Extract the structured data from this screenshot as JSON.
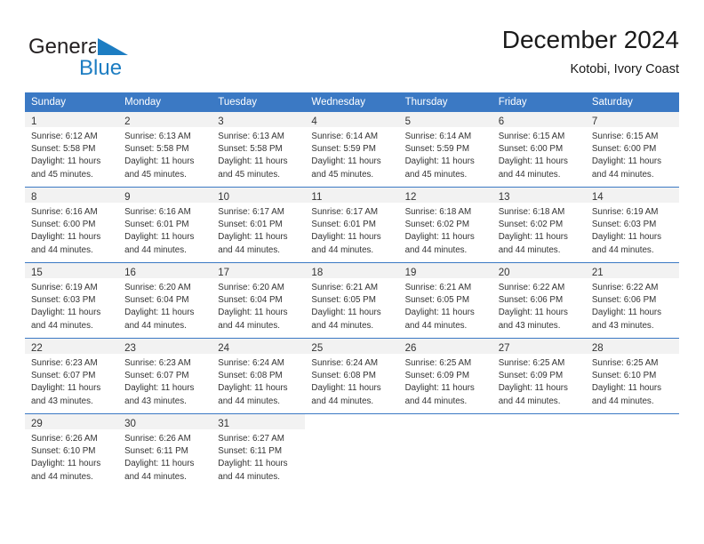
{
  "brand": {
    "name_top": "General",
    "name_bottom": "Blue",
    "triangle_icon": "blue-triangle-icon",
    "color_dark": "#231f20",
    "color_blue": "#1d7dc2"
  },
  "header": {
    "title": "December 2024",
    "subtitle": "Kotobi, Ivory Coast"
  },
  "theme": {
    "header_bg": "#3b79c4",
    "daynum_bg": "#f2f2f2",
    "text": "#333333",
    "page_bg": "#ffffff"
  },
  "calendar": {
    "weekday_headers": [
      "Sunday",
      "Monday",
      "Tuesday",
      "Wednesday",
      "Thursday",
      "Friday",
      "Saturday"
    ],
    "weeks": [
      [
        {
          "day": "1",
          "sunrise": "Sunrise: 6:12 AM",
          "sunset": "Sunset: 5:58 PM",
          "daylight_line1": "Daylight: 11 hours",
          "daylight_line2": "and 45 minutes."
        },
        {
          "day": "2",
          "sunrise": "Sunrise: 6:13 AM",
          "sunset": "Sunset: 5:58 PM",
          "daylight_line1": "Daylight: 11 hours",
          "daylight_line2": "and 45 minutes."
        },
        {
          "day": "3",
          "sunrise": "Sunrise: 6:13 AM",
          "sunset": "Sunset: 5:58 PM",
          "daylight_line1": "Daylight: 11 hours",
          "daylight_line2": "and 45 minutes."
        },
        {
          "day": "4",
          "sunrise": "Sunrise: 6:14 AM",
          "sunset": "Sunset: 5:59 PM",
          "daylight_line1": "Daylight: 11 hours",
          "daylight_line2": "and 45 minutes."
        },
        {
          "day": "5",
          "sunrise": "Sunrise: 6:14 AM",
          "sunset": "Sunset: 5:59 PM",
          "daylight_line1": "Daylight: 11 hours",
          "daylight_line2": "and 45 minutes."
        },
        {
          "day": "6",
          "sunrise": "Sunrise: 6:15 AM",
          "sunset": "Sunset: 6:00 PM",
          "daylight_line1": "Daylight: 11 hours",
          "daylight_line2": "and 44 minutes."
        },
        {
          "day": "7",
          "sunrise": "Sunrise: 6:15 AM",
          "sunset": "Sunset: 6:00 PM",
          "daylight_line1": "Daylight: 11 hours",
          "daylight_line2": "and 44 minutes."
        }
      ],
      [
        {
          "day": "8",
          "sunrise": "Sunrise: 6:16 AM",
          "sunset": "Sunset: 6:00 PM",
          "daylight_line1": "Daylight: 11 hours",
          "daylight_line2": "and 44 minutes."
        },
        {
          "day": "9",
          "sunrise": "Sunrise: 6:16 AM",
          "sunset": "Sunset: 6:01 PM",
          "daylight_line1": "Daylight: 11 hours",
          "daylight_line2": "and 44 minutes."
        },
        {
          "day": "10",
          "sunrise": "Sunrise: 6:17 AM",
          "sunset": "Sunset: 6:01 PM",
          "daylight_line1": "Daylight: 11 hours",
          "daylight_line2": "and 44 minutes."
        },
        {
          "day": "11",
          "sunrise": "Sunrise: 6:17 AM",
          "sunset": "Sunset: 6:01 PM",
          "daylight_line1": "Daylight: 11 hours",
          "daylight_line2": "and 44 minutes."
        },
        {
          "day": "12",
          "sunrise": "Sunrise: 6:18 AM",
          "sunset": "Sunset: 6:02 PM",
          "daylight_line1": "Daylight: 11 hours",
          "daylight_line2": "and 44 minutes."
        },
        {
          "day": "13",
          "sunrise": "Sunrise: 6:18 AM",
          "sunset": "Sunset: 6:02 PM",
          "daylight_line1": "Daylight: 11 hours",
          "daylight_line2": "and 44 minutes."
        },
        {
          "day": "14",
          "sunrise": "Sunrise: 6:19 AM",
          "sunset": "Sunset: 6:03 PM",
          "daylight_line1": "Daylight: 11 hours",
          "daylight_line2": "and 44 minutes."
        }
      ],
      [
        {
          "day": "15",
          "sunrise": "Sunrise: 6:19 AM",
          "sunset": "Sunset: 6:03 PM",
          "daylight_line1": "Daylight: 11 hours",
          "daylight_line2": "and 44 minutes."
        },
        {
          "day": "16",
          "sunrise": "Sunrise: 6:20 AM",
          "sunset": "Sunset: 6:04 PM",
          "daylight_line1": "Daylight: 11 hours",
          "daylight_line2": "and 44 minutes."
        },
        {
          "day": "17",
          "sunrise": "Sunrise: 6:20 AM",
          "sunset": "Sunset: 6:04 PM",
          "daylight_line1": "Daylight: 11 hours",
          "daylight_line2": "and 44 minutes."
        },
        {
          "day": "18",
          "sunrise": "Sunrise: 6:21 AM",
          "sunset": "Sunset: 6:05 PM",
          "daylight_line1": "Daylight: 11 hours",
          "daylight_line2": "and 44 minutes."
        },
        {
          "day": "19",
          "sunrise": "Sunrise: 6:21 AM",
          "sunset": "Sunset: 6:05 PM",
          "daylight_line1": "Daylight: 11 hours",
          "daylight_line2": "and 44 minutes."
        },
        {
          "day": "20",
          "sunrise": "Sunrise: 6:22 AM",
          "sunset": "Sunset: 6:06 PM",
          "daylight_line1": "Daylight: 11 hours",
          "daylight_line2": "and 43 minutes."
        },
        {
          "day": "21",
          "sunrise": "Sunrise: 6:22 AM",
          "sunset": "Sunset: 6:06 PM",
          "daylight_line1": "Daylight: 11 hours",
          "daylight_line2": "and 43 minutes."
        }
      ],
      [
        {
          "day": "22",
          "sunrise": "Sunrise: 6:23 AM",
          "sunset": "Sunset: 6:07 PM",
          "daylight_line1": "Daylight: 11 hours",
          "daylight_line2": "and 43 minutes."
        },
        {
          "day": "23",
          "sunrise": "Sunrise: 6:23 AM",
          "sunset": "Sunset: 6:07 PM",
          "daylight_line1": "Daylight: 11 hours",
          "daylight_line2": "and 43 minutes."
        },
        {
          "day": "24",
          "sunrise": "Sunrise: 6:24 AM",
          "sunset": "Sunset: 6:08 PM",
          "daylight_line1": "Daylight: 11 hours",
          "daylight_line2": "and 44 minutes."
        },
        {
          "day": "25",
          "sunrise": "Sunrise: 6:24 AM",
          "sunset": "Sunset: 6:08 PM",
          "daylight_line1": "Daylight: 11 hours",
          "daylight_line2": "and 44 minutes."
        },
        {
          "day": "26",
          "sunrise": "Sunrise: 6:25 AM",
          "sunset": "Sunset: 6:09 PM",
          "daylight_line1": "Daylight: 11 hours",
          "daylight_line2": "and 44 minutes."
        },
        {
          "day": "27",
          "sunrise": "Sunrise: 6:25 AM",
          "sunset": "Sunset: 6:09 PM",
          "daylight_line1": "Daylight: 11 hours",
          "daylight_line2": "and 44 minutes."
        },
        {
          "day": "28",
          "sunrise": "Sunrise: 6:25 AM",
          "sunset": "Sunset: 6:10 PM",
          "daylight_line1": "Daylight: 11 hours",
          "daylight_line2": "and 44 minutes."
        }
      ],
      [
        {
          "day": "29",
          "sunrise": "Sunrise: 6:26 AM",
          "sunset": "Sunset: 6:10 PM",
          "daylight_line1": "Daylight: 11 hours",
          "daylight_line2": "and 44 minutes."
        },
        {
          "day": "30",
          "sunrise": "Sunrise: 6:26 AM",
          "sunset": "Sunset: 6:11 PM",
          "daylight_line1": "Daylight: 11 hours",
          "daylight_line2": "and 44 minutes."
        },
        {
          "day": "31",
          "sunrise": "Sunrise: 6:27 AM",
          "sunset": "Sunset: 6:11 PM",
          "daylight_line1": "Daylight: 11 hours",
          "daylight_line2": "and 44 minutes."
        },
        null,
        null,
        null,
        null
      ]
    ]
  }
}
